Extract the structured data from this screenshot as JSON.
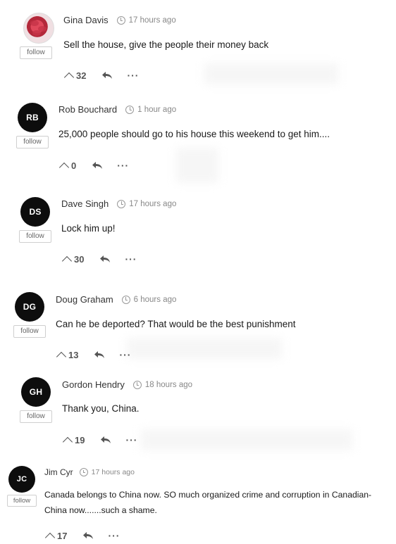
{
  "follow_label": "follow",
  "comments": [
    {
      "name": "Gina Davis",
      "time": "17 hours ago",
      "text": "Sell the house, give the people their money back",
      "votes": "32",
      "avatar": "photo"
    },
    {
      "name": "Rob Bouchard",
      "time": "1 hour ago",
      "text": "25,000 people should go to his house this weekend to get him....",
      "votes": "0",
      "avatar": "RB"
    },
    {
      "name": "Dave Singh",
      "time": "17 hours ago",
      "text": "Lock him up!",
      "votes": "30",
      "avatar": "DS"
    },
    {
      "name": "Doug Graham",
      "time": "6 hours ago",
      "text": "Can he be deported? That would be the best punishment",
      "votes": "13",
      "avatar": "DG"
    },
    {
      "name": "Gordon Hendry",
      "time": "18 hours ago",
      "text": "Thank you, China.",
      "votes": "19",
      "avatar": "GH"
    },
    {
      "name": "Jim Cyr",
      "time": "17 hours ago",
      "text": "Canada belongs to China now. SO much organized crime and corruption in Canadian-China now.......such a shame.",
      "votes": "17",
      "avatar": "JC"
    }
  ]
}
